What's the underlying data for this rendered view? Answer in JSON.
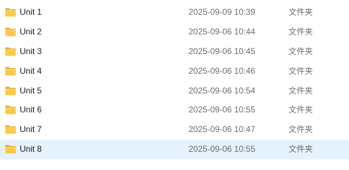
{
  "files": [
    {
      "name": "Unit 1",
      "modified": "2025-09-09 10:39",
      "type": "文件夹",
      "selected": false,
      "icon": "folder-icon"
    },
    {
      "name": "Unit 2",
      "modified": "2025-09-06 10:44",
      "type": "文件夹",
      "selected": false,
      "icon": "folder-icon"
    },
    {
      "name": "Unit 3",
      "modified": "2025-09-06 10:45",
      "type": "文件夹",
      "selected": false,
      "icon": "folder-icon"
    },
    {
      "name": "Unit 4",
      "modified": "2025-09-06 10:46",
      "type": "文件夹",
      "selected": false,
      "icon": "folder-icon"
    },
    {
      "name": "Unit 5",
      "modified": "2025-09-06 10:54",
      "type": "文件夹",
      "selected": false,
      "icon": "folder-icon"
    },
    {
      "name": "Unit 6",
      "modified": "2025-09-06 10:55",
      "type": "文件夹",
      "selected": false,
      "icon": "folder-icon"
    },
    {
      "name": "Unit 7",
      "modified": "2025-09-06 10:47",
      "type": "文件夹",
      "selected": false,
      "icon": "folder-icon"
    },
    {
      "name": "Unit 8",
      "modified": "2025-09-06 10:55",
      "type": "文件夹",
      "selected": true,
      "icon": "folder-icon"
    }
  ],
  "colors": {
    "folder_body": "#f8c94a",
    "folder_tab": "#e8a92a",
    "selection_bg": "#e5f1fb"
  }
}
